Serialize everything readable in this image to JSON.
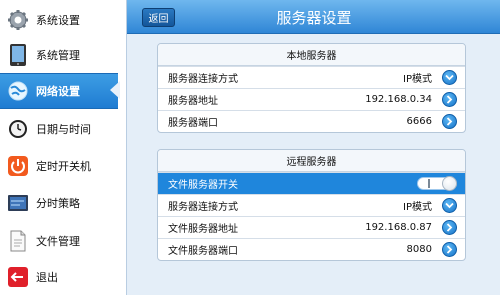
{
  "sidebar": {
    "items": [
      {
        "label": "系统设置",
        "icon": "gear-icon"
      },
      {
        "label": "系统管理",
        "icon": "tablet-icon"
      },
      {
        "label": "网络设置",
        "icon": "network-icon",
        "active": true
      },
      {
        "label": "日期与时间",
        "icon": "clock-icon"
      },
      {
        "label": "定时开关机",
        "icon": "power-icon"
      },
      {
        "label": "分时策略",
        "icon": "schedule-icon"
      },
      {
        "label": "文件管理",
        "icon": "document-icon"
      },
      {
        "label": "退出",
        "icon": "exit-icon"
      }
    ]
  },
  "header": {
    "back_label": "返回",
    "title": "服务器设置"
  },
  "local_server": {
    "title": "本地服务器",
    "rows": [
      {
        "label": "服务器连接方式",
        "value": "IP模式",
        "control": "dropdown"
      },
      {
        "label": "服务器地址",
        "value": "192.168.0.34",
        "control": "arrow"
      },
      {
        "label": "服务器端口",
        "value": "6666",
        "control": "arrow"
      }
    ]
  },
  "remote_server": {
    "title": "远程服务器",
    "rows": [
      {
        "label": "文件服务器开关",
        "value": "",
        "control": "toggle",
        "state": "on"
      },
      {
        "label": "服务器连接方式",
        "value": "IP模式",
        "control": "dropdown"
      },
      {
        "label": "文件服务器地址",
        "value": "192.168.0.87",
        "control": "arrow"
      },
      {
        "label": "文件服务器端口",
        "value": "8080",
        "control": "arrow"
      }
    ]
  },
  "colors": {
    "accent": "#1f86dc",
    "header": "#2f86d6",
    "panel_bg": "#e4eef8"
  }
}
